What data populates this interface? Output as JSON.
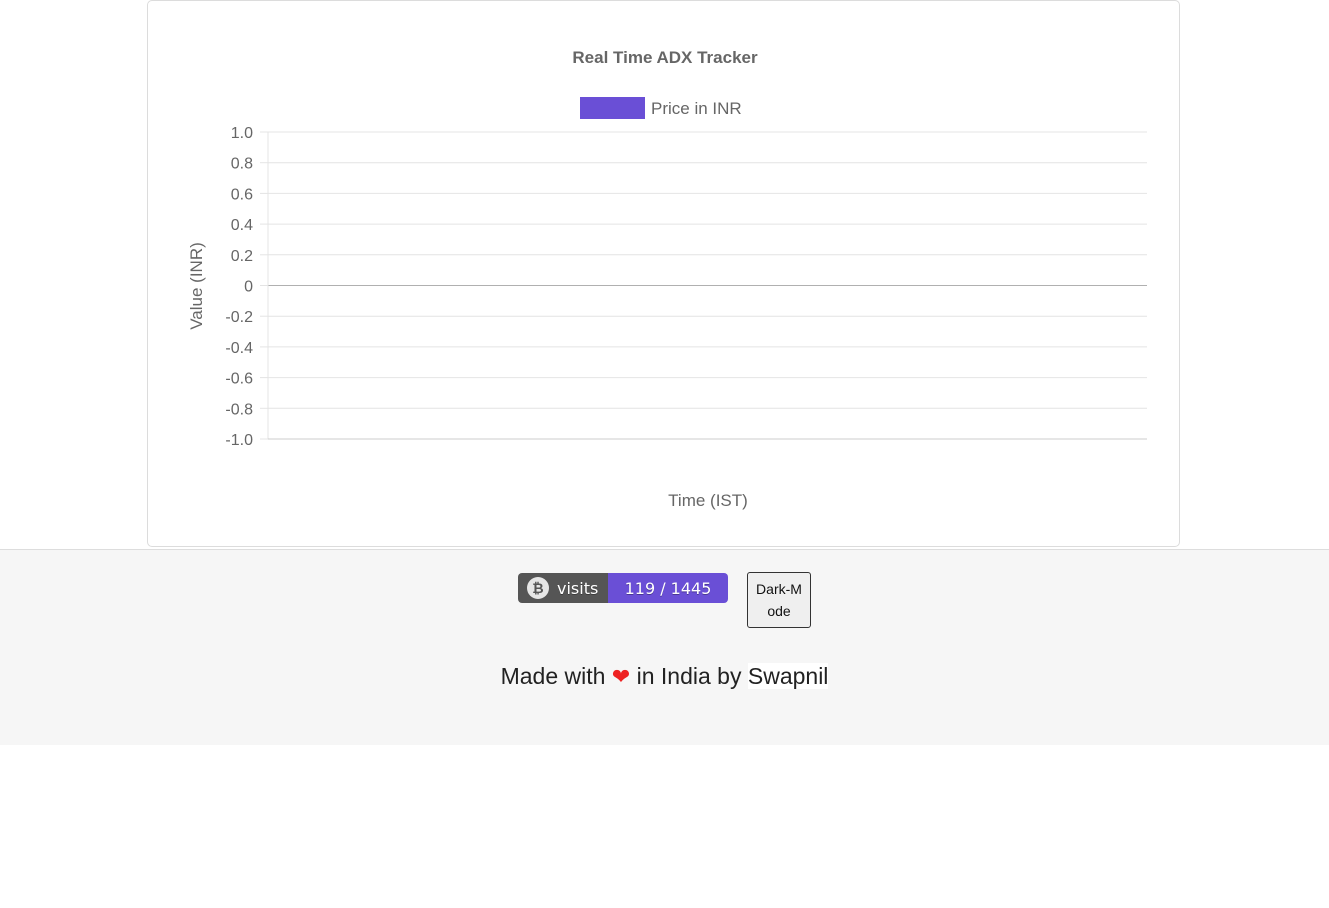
{
  "chart_data": {
    "type": "line",
    "title": "Real Time ADX Tracker",
    "series": [
      {
        "name": "Price in INR",
        "values": [],
        "color": "#6a4fd6"
      }
    ],
    "x": [],
    "xlabel": "Time (IST)",
    "ylabel": "Value (INR)",
    "ylim": [
      -1.0,
      1.0
    ],
    "yticks": [
      "1.0",
      "0.8",
      "0.6",
      "0.4",
      "0.2",
      "0",
      "-0.2",
      "-0.4",
      "-0.6",
      "-0.8",
      "-1.0"
    ],
    "grid": true,
    "legend": "top"
  },
  "footer": {
    "badge": {
      "icon": "bitcoin-icon",
      "label": "visits",
      "value": "119 / 1445",
      "left_color": "#555555",
      "right_color": "#6a4fd6"
    },
    "dark_mode_label": "Dark-Mode",
    "made_with_prefix": "Made with",
    "heart_icon": "heart-icon",
    "made_with_suffix": "in India by",
    "author": "Swapnil"
  }
}
